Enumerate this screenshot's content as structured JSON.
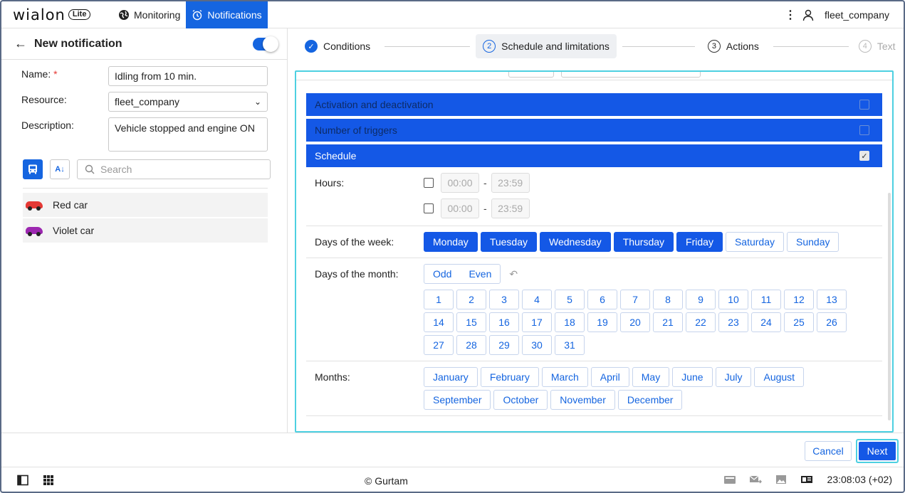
{
  "app": {
    "logo": "wialon",
    "logo_badge": "Lite"
  },
  "nav": {
    "monitoring": "Monitoring",
    "notifications": "Notifications"
  },
  "user": {
    "name": "fleet_company"
  },
  "left": {
    "title": "New notification",
    "name_label": "Name:",
    "name_value": "Idling from 10 min.",
    "resource_label": "Resource:",
    "resource_value": "fleet_company",
    "description_label": "Description:",
    "description_value": "Vehicle stopped and engine ON",
    "search_placeholder": "Search",
    "units": [
      {
        "name": "Red car",
        "color": "#e53935"
      },
      {
        "name": "Violet car",
        "color": "#9c27b0"
      }
    ]
  },
  "steps": [
    {
      "label": "Conditions",
      "num": "✓",
      "state": "done"
    },
    {
      "label": "Schedule and limitations",
      "num": "2",
      "state": "current"
    },
    {
      "label": "Actions",
      "num": "3",
      "state": "pending"
    },
    {
      "label": "Text",
      "num": "4",
      "state": "disabled"
    }
  ],
  "sections": {
    "activation": "Activation and deactivation",
    "triggers": "Number of triggers",
    "schedule": "Schedule"
  },
  "schedule": {
    "hours_label": "Hours:",
    "time_from": "00:00",
    "time_to": "23:59",
    "weekdays_label": "Days of the week:",
    "weekdays": [
      {
        "label": "Monday",
        "on": true
      },
      {
        "label": "Tuesday",
        "on": true
      },
      {
        "label": "Wednesday",
        "on": true
      },
      {
        "label": "Thursday",
        "on": true
      },
      {
        "label": "Friday",
        "on": true
      },
      {
        "label": "Saturday",
        "on": false
      },
      {
        "label": "Sunday",
        "on": false
      }
    ],
    "monthdays_label": "Days of the month:",
    "odd": "Odd",
    "even": "Even",
    "days": [
      "1",
      "2",
      "3",
      "4",
      "5",
      "6",
      "7",
      "8",
      "9",
      "10",
      "11",
      "12",
      "13",
      "14",
      "15",
      "16",
      "17",
      "18",
      "19",
      "20",
      "21",
      "22",
      "23",
      "24",
      "25",
      "26",
      "27",
      "28",
      "29",
      "30",
      "31"
    ],
    "months_label": "Months:",
    "months": [
      "January",
      "February",
      "March",
      "April",
      "May",
      "June",
      "July",
      "August",
      "September",
      "October",
      "November",
      "December"
    ]
  },
  "buttons": {
    "cancel": "Cancel",
    "next": "Next"
  },
  "status": {
    "copyright": "© Gurtam",
    "time": "23:08:03 (+02)"
  },
  "colors": {
    "accent": "#1565e0",
    "focus": "#4dd0e1"
  }
}
